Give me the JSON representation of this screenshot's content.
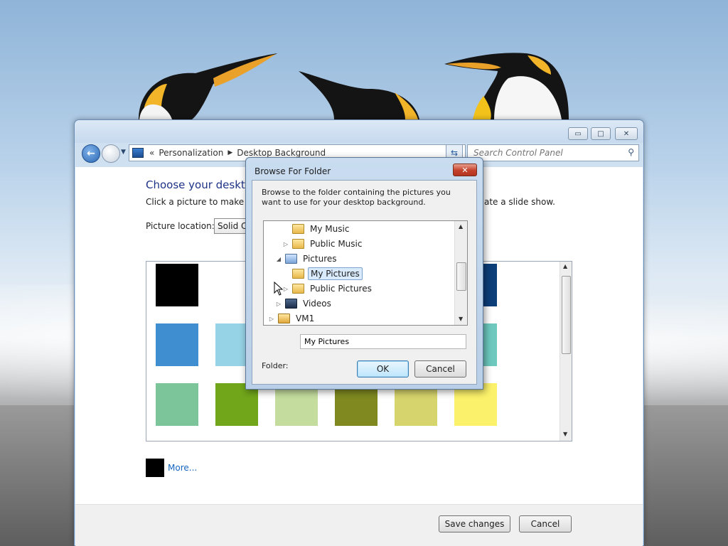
{
  "window": {
    "controls": {
      "minimize": "▭",
      "maximize": "□",
      "close": "✕"
    }
  },
  "navigation": {
    "breadcrumb_sep": "«",
    "breadcrumb": [
      "Personalization",
      "Desktop Background"
    ],
    "search_placeholder": "Search Control Panel"
  },
  "main": {
    "heading": "Choose your desktop",
    "subtext_left": "Click a picture to make it y",
    "subtext_right": "ate a slide show.",
    "picture_location_label": "Picture location:",
    "picture_location_value": "Solid Colors",
    "swatches": [
      "#000000",
      "#0c3e7a",
      "#3f8ed0",
      "#96d3e6",
      "#6dc9be",
      "#7cc59a",
      "#71a61a",
      "#c4dc9e",
      "#7f8920",
      "#d6d46c",
      "#fbf16a"
    ],
    "more_label": "More..."
  },
  "footer": {
    "save_label": "Save changes",
    "cancel_label": "Cancel"
  },
  "dialog": {
    "title": "Browse For Folder",
    "close": "✕",
    "instructions": "Browse to the folder containing the pictures you want to use for your desktop background.",
    "tree": [
      {
        "label": "My Music",
        "level": 3,
        "expander": "",
        "selected": false
      },
      {
        "label": "Public Music",
        "level": 3,
        "expander": "▷",
        "selected": false
      },
      {
        "label": "Pictures",
        "level": 2,
        "expander": "◢",
        "selected": false
      },
      {
        "label": "My Pictures",
        "level": 3,
        "expander": "",
        "selected": true
      },
      {
        "label": "Public Pictures",
        "level": 3,
        "expander": "▷",
        "selected": false
      },
      {
        "label": "Videos",
        "level": 2,
        "expander": "▷",
        "selected": false
      },
      {
        "label": "VM1",
        "level": 1,
        "expander": "▷",
        "selected": false
      }
    ],
    "folder_label": "Folder:",
    "folder_value": "My Pictures",
    "ok_label": "OK",
    "cancel_label": "Cancel"
  }
}
